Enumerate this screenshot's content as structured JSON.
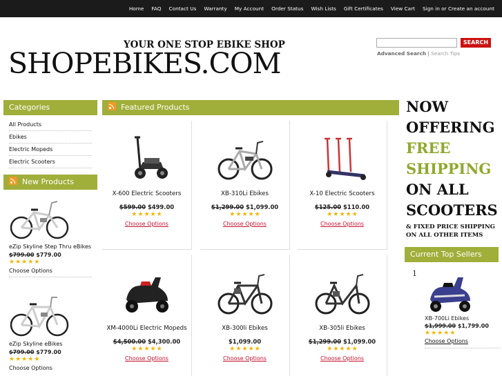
{
  "topnav": [
    "Home",
    "FAQ",
    "Contact Us",
    "Warranty",
    "My Account",
    "Order Status",
    "Wish Lists",
    "Gift Certificates",
    "View Cart",
    "Sign in or Create an account"
  ],
  "header": {
    "tagline": "YOUR ONE STOP EBIKE SHOP",
    "logo_text": "SHOPEBIKES.COM"
  },
  "search": {
    "placeholder": "",
    "button": "SEARCH",
    "advanced": "Advanced Search",
    "divider": "|",
    "tips": "Search Tips"
  },
  "categories": {
    "title": "Categories",
    "items": [
      "All Products",
      "Ebikes",
      "Electric Mopeds",
      "Electric Scooters"
    ]
  },
  "new_products": {
    "title": "New Products",
    "items": [
      {
        "name": "eZip Skyline Step Thru eBikes",
        "old_price": "$799.00",
        "price": "$779.00",
        "option": "Choose Options",
        "rating": 5
      },
      {
        "name": "eZip Skyline eBikes",
        "old_price": "$799.00",
        "price": "$779.00",
        "option": "Choose Options",
        "rating": 5
      }
    ]
  },
  "featured": {
    "title": "Featured Products",
    "items": [
      {
        "name": "X-600 Electric Scooters",
        "old_price": "$599.00",
        "price": "$499.00",
        "rating": 5,
        "option": "Choose Options",
        "icon": "scooter-icon"
      },
      {
        "name": "XB-310Li Ebikes",
        "old_price": "$1,299.00",
        "price": "$1,099.00",
        "rating": 5,
        "option": "Choose Options",
        "icon": "ebike-icon"
      },
      {
        "name": "X-10 Electric Scooters",
        "old_price": "$125.00",
        "price": "$110.00",
        "rating": 5,
        "option": "Choose Options",
        "icon": "scooter-icon"
      },
      {
        "name": "XM-4000Li Electric Mopeds",
        "old_price": "$4,500.00",
        "price": "$4,300.00",
        "rating": 5,
        "option": "Choose Options",
        "icon": "moped-icon"
      },
      {
        "name": "XB-300li Ebikes",
        "old_price": "",
        "price": "$1,099.00",
        "rating": 5,
        "option": "Choose Options",
        "icon": "ebike-icon"
      },
      {
        "name": "XB-305li Ebikes",
        "old_price": "$1,299.00",
        "price": "$1,099.00",
        "rating": 5,
        "option": "Choose Options",
        "icon": "ebike-icon"
      }
    ]
  },
  "promo": {
    "line1": "NOW",
    "line2": "OFFERING",
    "line3": "FREE",
    "line4": "SHIPPING",
    "line5": "ON ALL",
    "line6": "SCOOTERS",
    "small": "& FIXED PRICE SHIPPING ON ALL OTHER ITEMS"
  },
  "top_sellers": {
    "title": "Current Top Sellers",
    "items": [
      {
        "rank": "1",
        "name": "XB-700Li Ebikes",
        "old_price": "$1,999.00",
        "price": "$1,799.00",
        "rating": 5,
        "option": "Choose Options"
      }
    ]
  },
  "colors": {
    "panel": "#a0ae3a",
    "promo_green": "#8fa82e",
    "search_button": "#cc1111",
    "link_red": "#c8102e",
    "star": "#f4b400"
  }
}
